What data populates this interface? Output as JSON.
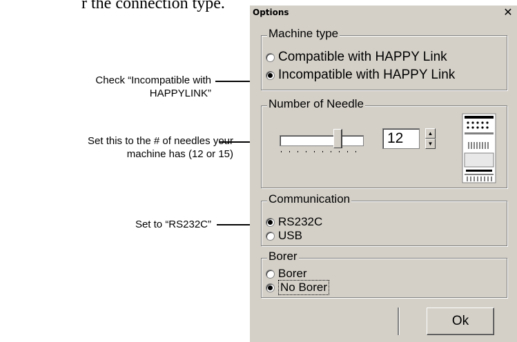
{
  "document": {
    "text_fragment": "r the connection type."
  },
  "callouts": {
    "machine_type": "Check “Incompatible with\nHAPPYLINK”",
    "needles": "Set this to the # of needles your\nmachine has (12 or 15)",
    "communication": "Set to “RS232C”"
  },
  "dialog": {
    "title": "Options",
    "close_glyph": "✕",
    "machine_type": {
      "legend": "Machine type",
      "options": [
        {
          "label": "Compatible with HAPPY Link",
          "selected": false
        },
        {
          "label": "Incompatible with HAPPY Link",
          "selected": true
        }
      ]
    },
    "needles": {
      "legend": "Number of Needle",
      "value": "12",
      "up_glyph": "▲",
      "down_glyph": "▼"
    },
    "communication": {
      "legend": "Communication",
      "options": [
        {
          "label": "RS232C",
          "selected": true
        },
        {
          "label": "USB",
          "selected": false
        }
      ]
    },
    "borer": {
      "legend": "Borer",
      "options": [
        {
          "label": "Borer",
          "selected": false
        },
        {
          "label": "No Borer",
          "selected": true
        }
      ]
    },
    "ok_label": "Ok"
  }
}
